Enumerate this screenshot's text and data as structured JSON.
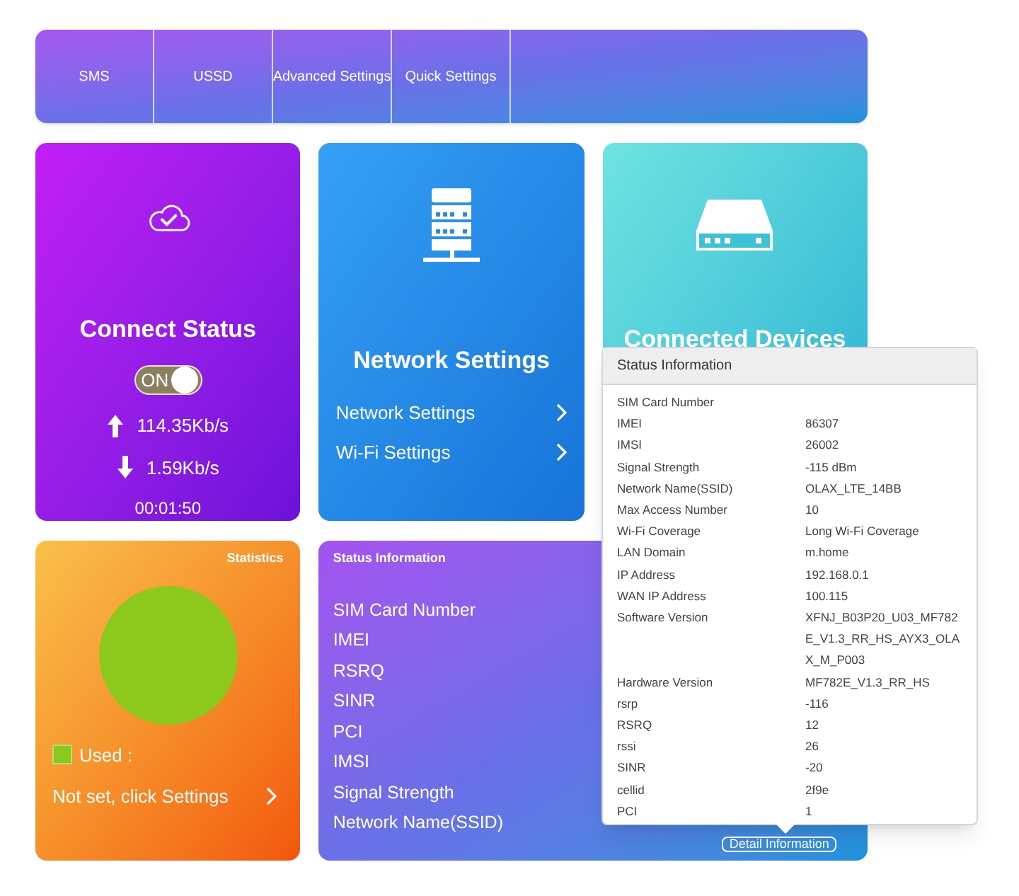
{
  "nav": [
    {
      "label": "SMS"
    },
    {
      "label": "USSD"
    },
    {
      "label": "Advanced Settings"
    },
    {
      "label": "Quick Settings"
    }
  ],
  "connect": {
    "title": "Connect Status",
    "toggle": {
      "label": "ON",
      "on": true
    },
    "upload": "114.35Kb/s",
    "download": "1.59Kb/s",
    "time": "00:01:50"
  },
  "network": {
    "title": "Network Settings",
    "links": [
      {
        "label": "Network Settings"
      },
      {
        "label": "Wi-Fi Settings"
      }
    ]
  },
  "devices": {
    "title": "Connected Devices"
  },
  "statistics": {
    "title": "Statistics",
    "legend": {
      "label": "Used :",
      "color": "#8cc91c"
    },
    "link": "Not set, click Settings"
  },
  "status_card": {
    "title": "Status Information",
    "items": [
      "SIM Card Number",
      "IMEI",
      "RSRQ",
      "SINR",
      "PCI",
      "IMSI",
      "Signal Strength",
      "Network Name(SSID)"
    ],
    "button": "Detail Information"
  },
  "popup": {
    "title": "Status Information",
    "rows": [
      {
        "label": "SIM Card Number"
      },
      {
        "label": "IMEI",
        "value": "86307"
      },
      {
        "label": "IMSI",
        "value": "26002"
      },
      {
        "label": "Signal Strength",
        "value": "-115 dBm"
      },
      {
        "label": "Network Name(SSID)",
        "value": "OLAX_LTE_14BB"
      },
      {
        "label": "Max Access Number",
        "value": "10"
      },
      {
        "label": "Wi-Fi Coverage",
        "value": "Long Wi-Fi Coverage"
      },
      {
        "label": "LAN Domain",
        "value": "m.home"
      },
      {
        "label": "IP Address",
        "value": "192.168.0.1"
      },
      {
        "label": "WAN IP Address",
        "value": "100.115"
      },
      {
        "label": "Software Version",
        "value": "XFNJ_B03P20_U03_MF782E_V1.3_RR_HS_AYX3_OLAX_M_P003"
      },
      {
        "label": "Hardware Version",
        "value": "MF782E_V1.3_RR_HS"
      },
      {
        "label": "rsrp",
        "value": "-116"
      },
      {
        "label": "RSRQ",
        "value": "12"
      },
      {
        "label": "rssi",
        "value": "26"
      },
      {
        "label": "SINR",
        "value": "-20"
      },
      {
        "label": "cellid",
        "value": "2f9e"
      },
      {
        "label": "PCI",
        "value": "1"
      }
    ]
  }
}
